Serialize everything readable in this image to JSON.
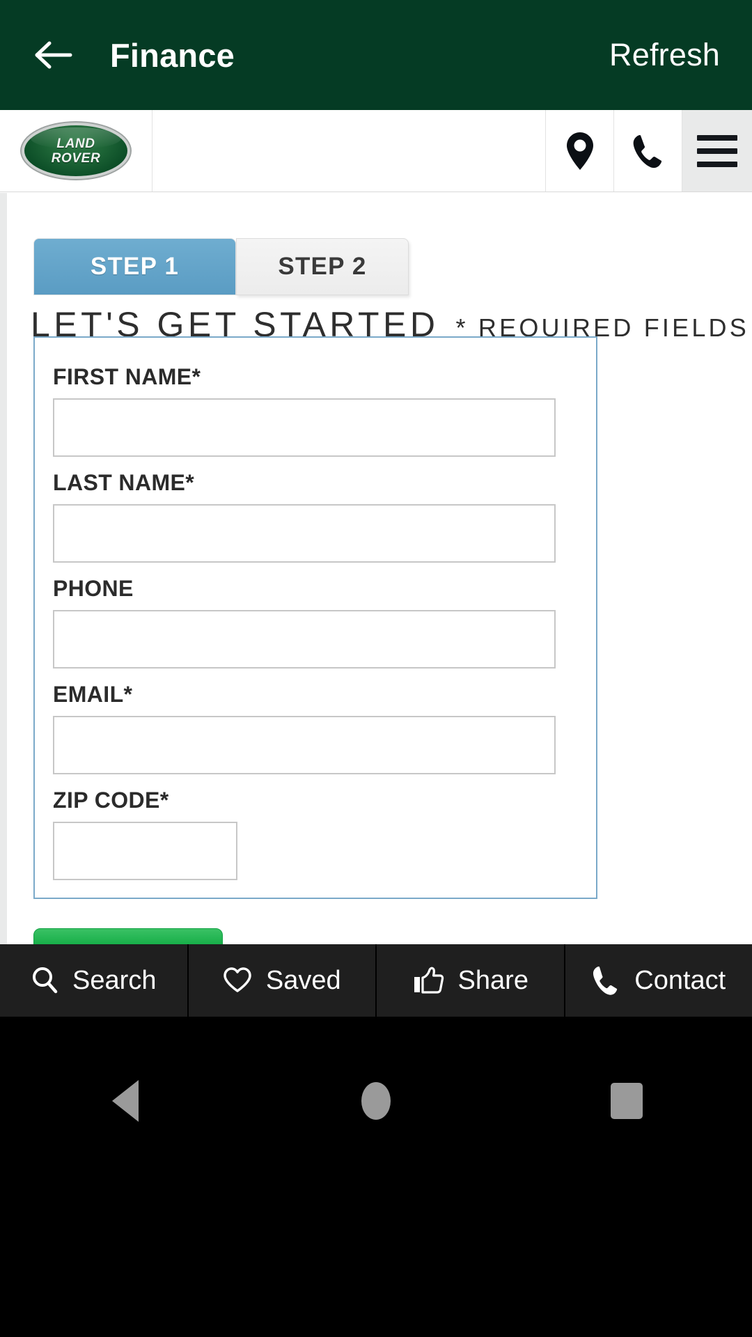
{
  "app_header": {
    "back_icon": "back-arrow-icon",
    "title": "Finance",
    "refresh_label": "Refresh"
  },
  "site_nav": {
    "logo": {
      "brand": "Land Rover",
      "line1": "LAND",
      "line2": "ROVER"
    },
    "icons": [
      {
        "name": "location-pin-icon",
        "label": "Location"
      },
      {
        "name": "phone-icon",
        "label": "Phone"
      },
      {
        "name": "hamburger-menu-icon",
        "label": "Menu"
      }
    ]
  },
  "form_page": {
    "tabs": [
      {
        "label": "STEP 1",
        "active": true
      },
      {
        "label": "STEP 2",
        "active": false
      }
    ],
    "headline": "LET'S GET STARTED",
    "required_note": "* REQUIRED FIELDS",
    "fields": [
      {
        "label": "FIRST NAME*",
        "value": "",
        "placeholder": "",
        "width": "full"
      },
      {
        "label": "LAST NAME*",
        "value": "",
        "placeholder": "",
        "width": "full"
      },
      {
        "label": "PHONE",
        "value": "",
        "placeholder": "",
        "width": "full"
      },
      {
        "label": "EMAIL*",
        "value": "",
        "placeholder": "",
        "width": "full"
      },
      {
        "label": "ZIP CODE*",
        "value": "",
        "placeholder": "",
        "width": "narrow"
      }
    ],
    "submit_label": "",
    "chat_widget": {
      "icon": "chat-bubbles-icon"
    }
  },
  "bottom_bar": {
    "items": [
      {
        "label": "Search",
        "icon": "search-icon"
      },
      {
        "label": "Saved",
        "icon": "heart-icon"
      },
      {
        "label": "Share",
        "icon": "thumbs-up-icon"
      },
      {
        "label": "Contact",
        "icon": "phone-icon"
      }
    ]
  },
  "android_nav": {
    "back": "back-triangle-icon",
    "home": "home-circle-icon",
    "recents": "recents-square-icon"
  },
  "colors": {
    "header_green": "#053b24",
    "tab_active_blue": "#5a9cc3",
    "form_border_blue": "#7aa9c9",
    "submit_green": "#00a13a",
    "chat_navy": "#121621",
    "bottom_bar": "#1f1f1f"
  }
}
